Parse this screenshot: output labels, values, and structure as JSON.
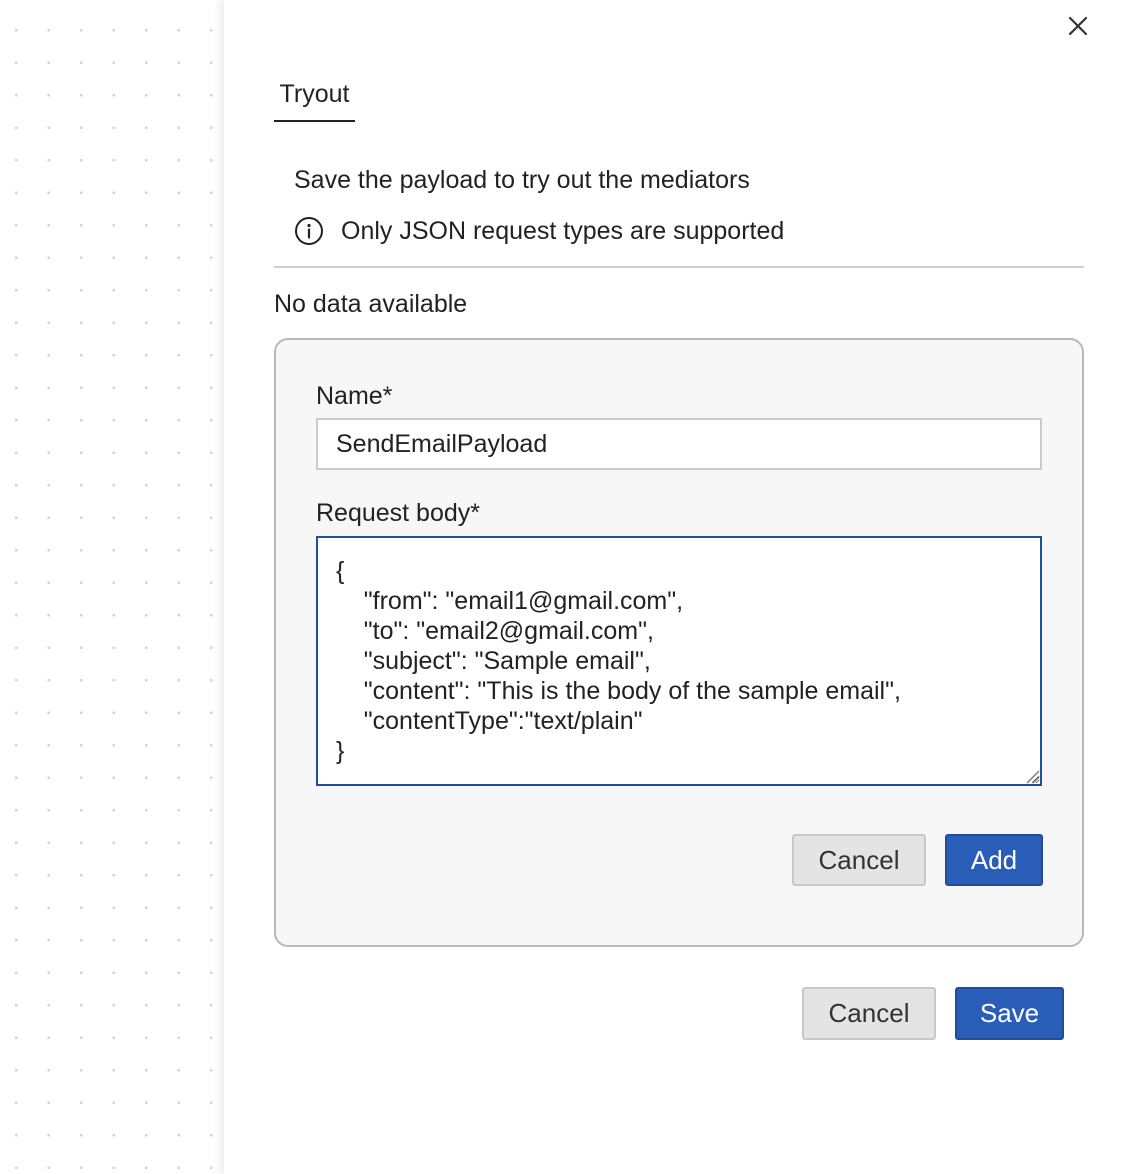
{
  "panel": {
    "close_icon": "close-icon"
  },
  "tabs": [
    {
      "label": "Tryout",
      "active": true
    }
  ],
  "description": "Save the payload to try out the mediators",
  "info": {
    "icon": "info-icon",
    "text": "Only JSON request types are supported"
  },
  "payloads": {
    "empty_text": "No data available"
  },
  "form": {
    "name_label": "Name*",
    "name_value": "SendEmailPayload",
    "body_label": "Request body*",
    "body_value": "{\n    \"from\": \"email1@gmail.com\",\n    \"to\": \"email2@gmail.com\",\n    \"subject\": \"Sample email\",\n    \"content\": \"This is the body of the sample email\",\n    \"contentType\":\"text/plain\"\n}",
    "cancel_label": "Cancel",
    "add_label": "Add"
  },
  "footer": {
    "cancel_label": "Cancel",
    "save_label": "Save"
  },
  "colors": {
    "primary": "#2a5db8",
    "focus_border": "#1f4e9a",
    "secondary_bg": "#e4e4e4"
  }
}
